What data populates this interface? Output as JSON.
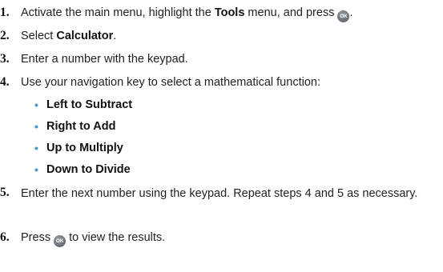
{
  "steps": [
    {
      "num": "1.",
      "pre": "Activate the main menu, highlight the ",
      "bold": "Tools",
      "mid": " menu, and press ",
      "post": "."
    },
    {
      "num": "2.",
      "pre": "Select ",
      "bold": "Calculator",
      "post": "."
    },
    {
      "num": "3.",
      "text": "Enter a number with the keypad."
    },
    {
      "num": "4.",
      "text": "Use your navigation key to select a mathematical function:"
    },
    {
      "num": "5.",
      "text": "Enter the next number using the keypad. Repeat steps 4 and 5 as necessary."
    },
    {
      "num": "6.",
      "pre": "Press ",
      "post": " to view the results."
    }
  ],
  "bullets": [
    "Left to Subtract",
    "Right to Add",
    "Up to Multiply",
    "Down to Divide"
  ],
  "bullet_glyph": "•",
  "ok_icon_label": "OK",
  "colors": {
    "bullet": "#3aa0dc",
    "ok_icon": "#6b7078"
  }
}
